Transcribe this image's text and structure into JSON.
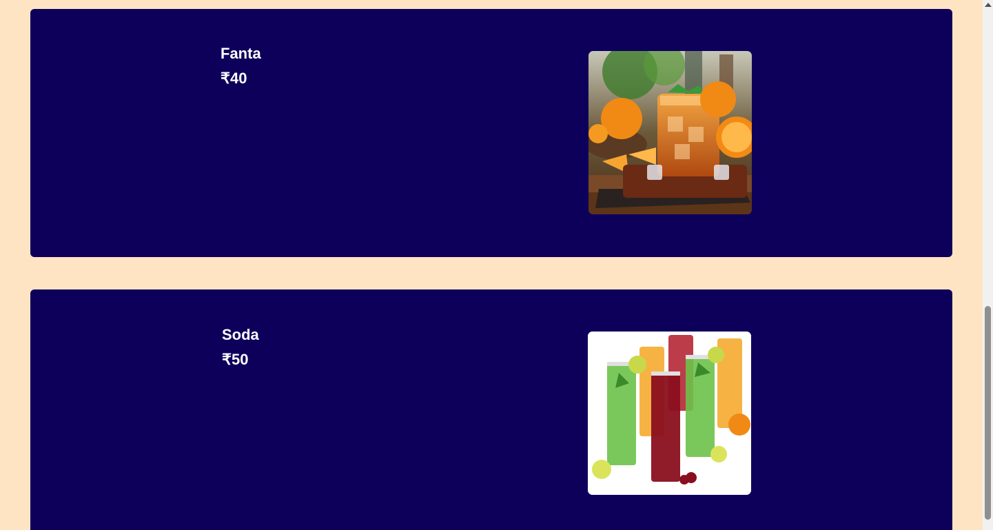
{
  "products": [
    {
      "name": "Fanta",
      "price": "₹40",
      "image_alt": "Fanta",
      "image_icon": "orange-drink-photo"
    },
    {
      "name": "Soda",
      "price": "₹50",
      "image_alt": "Soda",
      "image_icon": "soda-glasses-photo"
    }
  ],
  "colors": {
    "background": "#ffe4c4",
    "card": "#0d005b",
    "text": "#ffffff"
  }
}
